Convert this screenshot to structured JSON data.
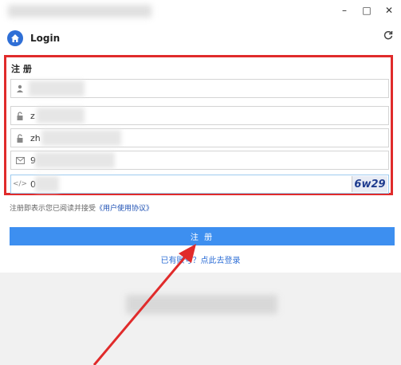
{
  "window": {
    "controls": {
      "minimize": "–",
      "maximize": "□",
      "close": "✕"
    }
  },
  "header": {
    "title": "Login",
    "home_icon": "home-icon",
    "refresh_icon": "refresh-icon"
  },
  "form": {
    "title": "注 册",
    "fields": [
      {
        "icon": "user-icon",
        "value": ""
      },
      {
        "icon": "lock-icon",
        "value": "z"
      },
      {
        "icon": "lock-icon",
        "value": "zh"
      },
      {
        "icon": "mail-icon",
        "value": "9"
      },
      {
        "icon": "code-icon",
        "value": "0"
      }
    ],
    "captcha_text": "6w29"
  },
  "agreement": {
    "text": "注册即表示您已阅读并接受",
    "link": "《用户使用协议》"
  },
  "submit_label": "注 册",
  "login_link": "已有账号？点此去登录",
  "colors": {
    "accent": "#3d8ff0",
    "highlight_border": "#e02b2b",
    "link": "#1c4fb3"
  }
}
